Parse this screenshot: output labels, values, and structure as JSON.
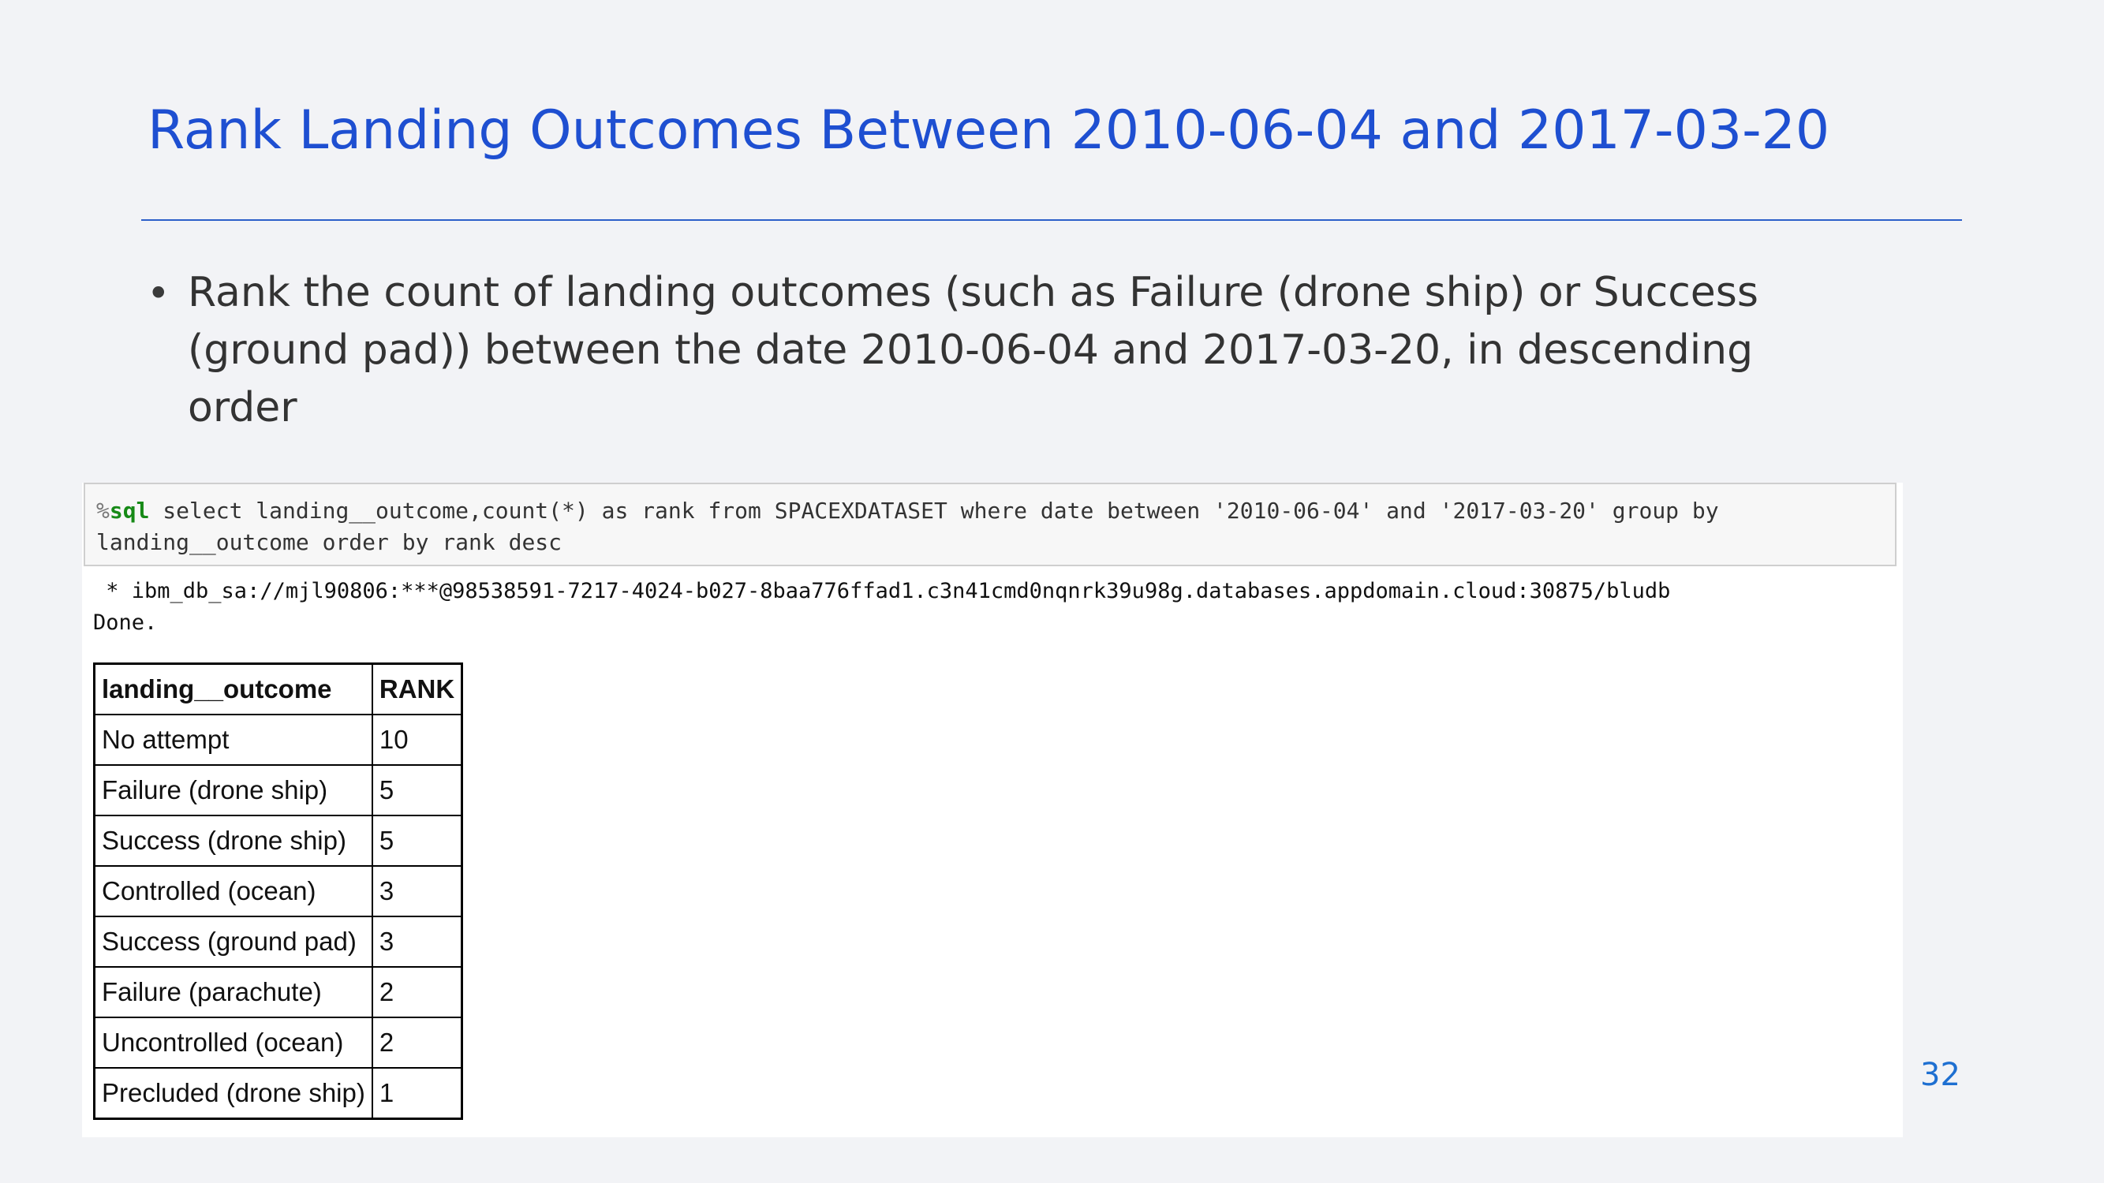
{
  "slide": {
    "title": "Rank Landing Outcomes Between 2010-06-04 and 2017-03-20",
    "bullet_dot": "•",
    "bullet_text": "Rank the count of landing outcomes (such as Failure (drone ship) or Success (ground pad)) between the date 2010-06-04 and 2017-03-20, in descending order",
    "page_number": "32"
  },
  "notebook": {
    "code_magic": "%",
    "code_keyword": "sql",
    "code_rest": " select landing__outcome,count(*) as rank from SPACEXDATASET where date between '2010-06-04' and '2017-03-20' group by landing__outcome order by rank desc",
    "output_connection": " * ibm_db_sa://mjl90806:***@98538591-7217-4024-b027-8baa776ffad1.c3n41cmd0nqnrk39u98g.databases.appdomain.cloud:30875/bludb",
    "output_status": "Done."
  },
  "table": {
    "headers": [
      "landing__outcome",
      "RANK"
    ],
    "rows": [
      [
        "No attempt",
        "10"
      ],
      [
        "Failure (drone ship)",
        "5"
      ],
      [
        "Success (drone ship)",
        "5"
      ],
      [
        "Controlled (ocean)",
        "3"
      ],
      [
        "Success (ground pad)",
        "3"
      ],
      [
        "Failure (parachute)",
        "2"
      ],
      [
        "Uncontrolled (ocean)",
        "2"
      ],
      [
        "Precluded (drone ship)",
        "1"
      ]
    ]
  },
  "colors": {
    "title": "#1e4fd1",
    "rule": "#2c5fc9",
    "page_number": "#1e6fd1",
    "sql_keyword": "#178a17",
    "slide_background": "#f2f3f6"
  }
}
